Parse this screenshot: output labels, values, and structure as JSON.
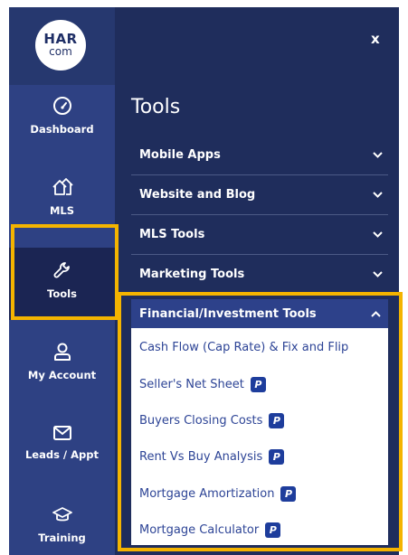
{
  "logo": {
    "line1": "HAR",
    "line2": "com"
  },
  "close_label": "x",
  "sidebar": {
    "items": [
      {
        "label": "Dashboard",
        "icon": "gauge-icon"
      },
      {
        "label": "MLS",
        "icon": "houses-icon"
      },
      {
        "label": "Tools",
        "icon": "wrench-icon",
        "active": true
      },
      {
        "label": "My Account",
        "icon": "user-icon"
      },
      {
        "label": "Leads / Appt",
        "icon": "envelope-icon"
      },
      {
        "label": "Training",
        "icon": "graduation-cap-icon"
      }
    ]
  },
  "panel": {
    "title": "Tools",
    "sections": [
      {
        "label": "Mobile Apps"
      },
      {
        "label": "Website and Blog"
      },
      {
        "label": "MLS Tools"
      },
      {
        "label": "Marketing Tools"
      }
    ],
    "open_section": {
      "label": "Financial/Investment Tools",
      "items": [
        {
          "label": "Cash Flow (Cap Rate) & Fix and Flip",
          "badge": ""
        },
        {
          "label": "Seller's Net Sheet",
          "badge": "P"
        },
        {
          "label": "Buyers Closing Costs",
          "badge": "P"
        },
        {
          "label": "Rent Vs Buy Analysis",
          "badge": "P"
        },
        {
          "label": "Mortgage Amortization",
          "badge": "P"
        },
        {
          "label": "Mortgage Calculator",
          "badge": "P"
        }
      ]
    }
  },
  "colors": {
    "rail": "#2e4183",
    "panel": "#1f2d5c",
    "highlight": "#f4b400",
    "link": "#2d4496"
  }
}
